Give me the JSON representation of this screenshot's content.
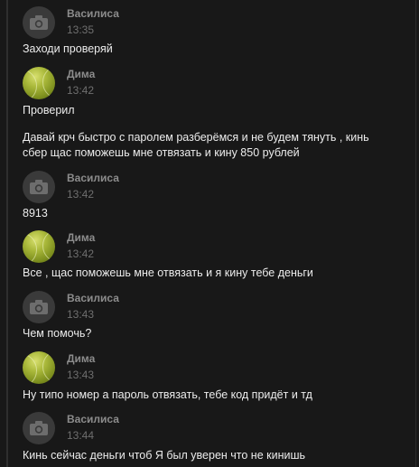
{
  "messages": [
    {
      "author": "Василиса",
      "time": "13:35",
      "avatar": "camera-icon",
      "lines": [
        "Заходи проверяй"
      ]
    },
    {
      "author": "Дима",
      "time": "13:42",
      "avatar": "tennis-ball-avatar",
      "lines": [
        "Проверил",
        "",
        "Давай крч быстро с паролем разберёмся и не будем тянуть , кинь",
        "сбер щас поможешь мне отвязать и кину 850 рублей"
      ]
    },
    {
      "author": "Василиса",
      "time": "13:42",
      "avatar": "camera-icon",
      "lines": [
        "8913"
      ]
    },
    {
      "author": "Дима",
      "time": "13:42",
      "avatar": "tennis-ball-avatar",
      "lines": [
        "Все , щас поможешь мне отвязать и я кину тебе деньги"
      ]
    },
    {
      "author": "Василиса",
      "time": "13:43",
      "avatar": "camera-icon",
      "lines": [
        "Чем помочь?"
      ]
    },
    {
      "author": "Дима",
      "time": "13:43",
      "avatar": "tennis-ball-avatar",
      "lines": [
        "Ну типо номер а пароль отвязать, тебе код придёт и тд"
      ]
    },
    {
      "author": "Василиса",
      "time": "13:44",
      "avatar": "camera-icon",
      "lines": [
        "Кинь сейчас деньги чтоб Я был уверен что не кинишь"
      ]
    }
  ],
  "colors": {
    "background": "#181818",
    "author": "#8c8c8c",
    "time": "#6f6f6f",
    "text": "#ececec"
  }
}
